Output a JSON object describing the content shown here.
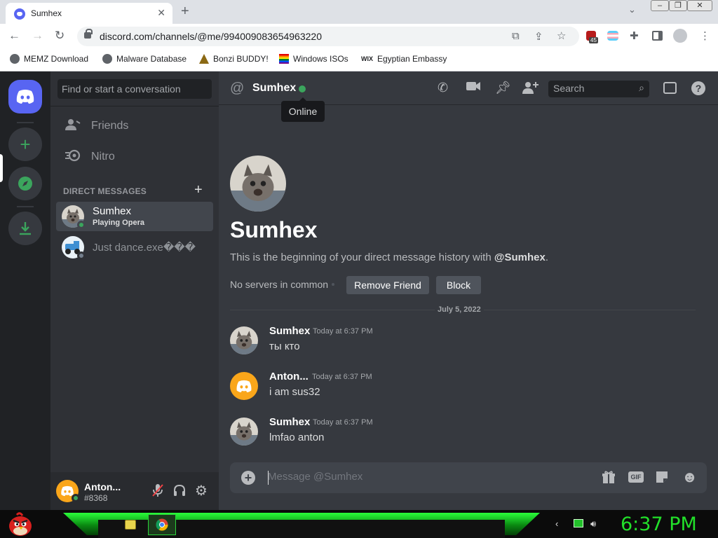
{
  "browser": {
    "tab_title": "Sumhex",
    "tab_close": "✕",
    "new_tab": "+",
    "url": "discord.com/channels/@me/994009083654963220",
    "extension_badge": "45",
    "bookmarks": [
      "MEMZ Download",
      "Malware Database",
      "Bonzi BUDDY!",
      "Windows ISOs",
      "Egyptian Embassy"
    ]
  },
  "sidebar": {
    "search_placeholder": "Find or start a conversation",
    "nav": [
      {
        "label": "Friends",
        "icon": "friends-icon"
      },
      {
        "label": "Nitro",
        "icon": "nitro-icon"
      }
    ],
    "dm_header": "DIRECT MESSAGES",
    "dm_add": "+",
    "dms": [
      {
        "name": "Sumhex",
        "activity": "Playing Opera",
        "status": "online",
        "selected": true
      },
      {
        "name": "Just dance.exe���",
        "activity": "",
        "status": "offline",
        "selected": false
      }
    ]
  },
  "user_panel": {
    "username": "Anton...",
    "tag": "#8368",
    "status": "online"
  },
  "chat": {
    "header_name": "Sumhex",
    "tooltip": "Online",
    "search_placeholder": "Search",
    "intro_name": "Sumhex",
    "intro_prefix": "This is the beginning of your direct message history with ",
    "intro_handle": "@Sumhex",
    "intro_suffix": ".",
    "no_servers": "No servers in common",
    "remove_friend": "Remove Friend",
    "block": "Block",
    "date_divider": "July 5, 2022",
    "messages": [
      {
        "author": "Sumhex",
        "time": "Today at 6:37 PM",
        "text": "ты кто",
        "avatar": "cat"
      },
      {
        "author": "Anton...",
        "time": "Today at 6:37 PM",
        "text": "i am sus32",
        "avatar": "discord-default"
      },
      {
        "author": "Sumhex",
        "time": "Today at 6:37 PM",
        "text": "lmfao anton",
        "avatar": "cat"
      }
    ],
    "composer_placeholder": "Message @Sumhex"
  },
  "taskbar": {
    "clock": "6:37 PM"
  },
  "colors": {
    "blurple": "#5865f2",
    "online": "#3ba55d",
    "default_avatar": "#faa61a",
    "clock_green": "#22e02a"
  }
}
